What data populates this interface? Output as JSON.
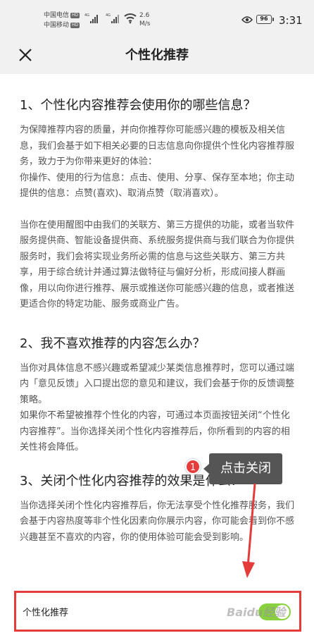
{
  "status_bar": {
    "carrier1": "中国电信",
    "carrier2": "中国移动",
    "hd_tag": "HD",
    "sig_tag": "4G",
    "speed_value": "2.6",
    "speed_unit": "M/s",
    "battery": "96",
    "time": "3:31"
  },
  "header": {
    "title": "个性化推荐"
  },
  "sections": [
    {
      "title": "1、个性化内容推荐会使用你的哪些信息？",
      "paragraphs": [
        "为保障推荐内容的质量，并向你推荐你可能感兴趣的模板及相关信息，我们会基于如下相关必要的日志信息向你提供个性化内容推荐服务，致力于为你带来更好的体验：\n你操作、使用的行为信息：点击、使用、分享、保存至本地；你主动提供的信息：点赞(喜欢)、取消点赞（取消喜欢）。",
        "当你在使用醒图中由我们的关联方、第三方提供的功能，或者当软件服务提供商、智能设备提供商、系统服务提供商与我们联合为你提供服务时，我们会将实现业务所必需的信息与这些关联方、第三方共享，用于综合统计并通过算法做特征与偏好分析，形成间接人群画像，用以向你进行推荐、展示或推送你可能感兴趣的信息，或者推送更适合你的特定功能、服务或商业广告。"
      ]
    },
    {
      "title": "2、我不喜欢推荐的内容怎么办？",
      "paragraphs": [
        "当你对具体信息不感兴趣或希望减少某类信息推荐时，您可以通过端内「意见反馈」入口提出您的意见和建议，我们会基于你的反馈调整策略。\n如果你不希望被推荐个性化的内容，可通过本页面按钮关闭“个性化内容推荐”。当你选择关闭个性化内容推荐后，你所看到的内容的相关性将会降低。"
      ]
    },
    {
      "title": "3、关闭个性化内容推荐的效果是什么？",
      "paragraphs": [
        "当你选择关闭个性化内容推荐后，你无法享受个性化推荐服务，我们会基于内容热度等非个性化因素向你展示内容，你可能会看到你不感兴趣甚至不喜欢的内容，你的使用体验可能会受到影响。"
      ]
    }
  ],
  "toggle": {
    "label": "个性化推荐",
    "state": "on",
    "color": "#8ad13f"
  },
  "annotation": {
    "step": "1",
    "text": "点击关闭",
    "color": "#e43b3b"
  },
  "watermark": "Baidu经验"
}
